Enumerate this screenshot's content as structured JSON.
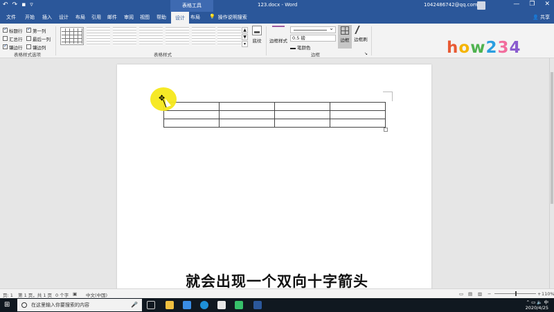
{
  "titlebar": {
    "context_title": "表格工具",
    "doc_title": "123.docx - Word",
    "account": "1042486742@qq.com",
    "window_buttons": [
      "—",
      "❐",
      "✕"
    ]
  },
  "tabs": [
    {
      "label": "文件",
      "active": false
    },
    {
      "label": "开始",
      "active": false
    },
    {
      "label": "插入",
      "active": false
    },
    {
      "label": "设计",
      "active": false
    },
    {
      "label": "布局",
      "active": false
    },
    {
      "label": "引用",
      "active": false
    },
    {
      "label": "邮件",
      "active": false
    },
    {
      "label": "审阅",
      "active": false
    },
    {
      "label": "视图",
      "active": false
    },
    {
      "label": "帮助",
      "active": false
    },
    {
      "label": "设计",
      "active": true
    },
    {
      "label": "布局",
      "active": false
    }
  ],
  "tellme": "操作说明搜索",
  "share": "共享",
  "ribbon": {
    "style_options": [
      {
        "label": "标题行",
        "checked": true
      },
      {
        "label": "第一列",
        "checked": true
      },
      {
        "label": "汇总行",
        "checked": false
      },
      {
        "label": "最后一列",
        "checked": false
      },
      {
        "label": "镶边行",
        "checked": true
      },
      {
        "label": "镶边列",
        "checked": false
      }
    ],
    "style_options_label": "表格样式选项",
    "table_styles_label": "表格样式",
    "shading_label": "底纹",
    "border_styles_label": "边框样式",
    "pen_weight": "0.5 磅",
    "pen_color_label": "笔颜色",
    "borders_label": "边框",
    "border_painter_label": "边框刷",
    "borders_group_label": "边框"
  },
  "logo_text": "how234",
  "subtitle": "就会出现一个双向十字箭头",
  "status": {
    "page": "页: 1",
    "section": "第 1 页，共 1 页",
    "words": "0 个字",
    "language": "中文(中国)",
    "zoom": "110%"
  },
  "taskbar": {
    "search_placeholder": "在这里输入你要搜索的内容",
    "date": "2020/4/25"
  },
  "colors": {
    "accent": "#2b579a",
    "highlight": "#f6e81a"
  }
}
